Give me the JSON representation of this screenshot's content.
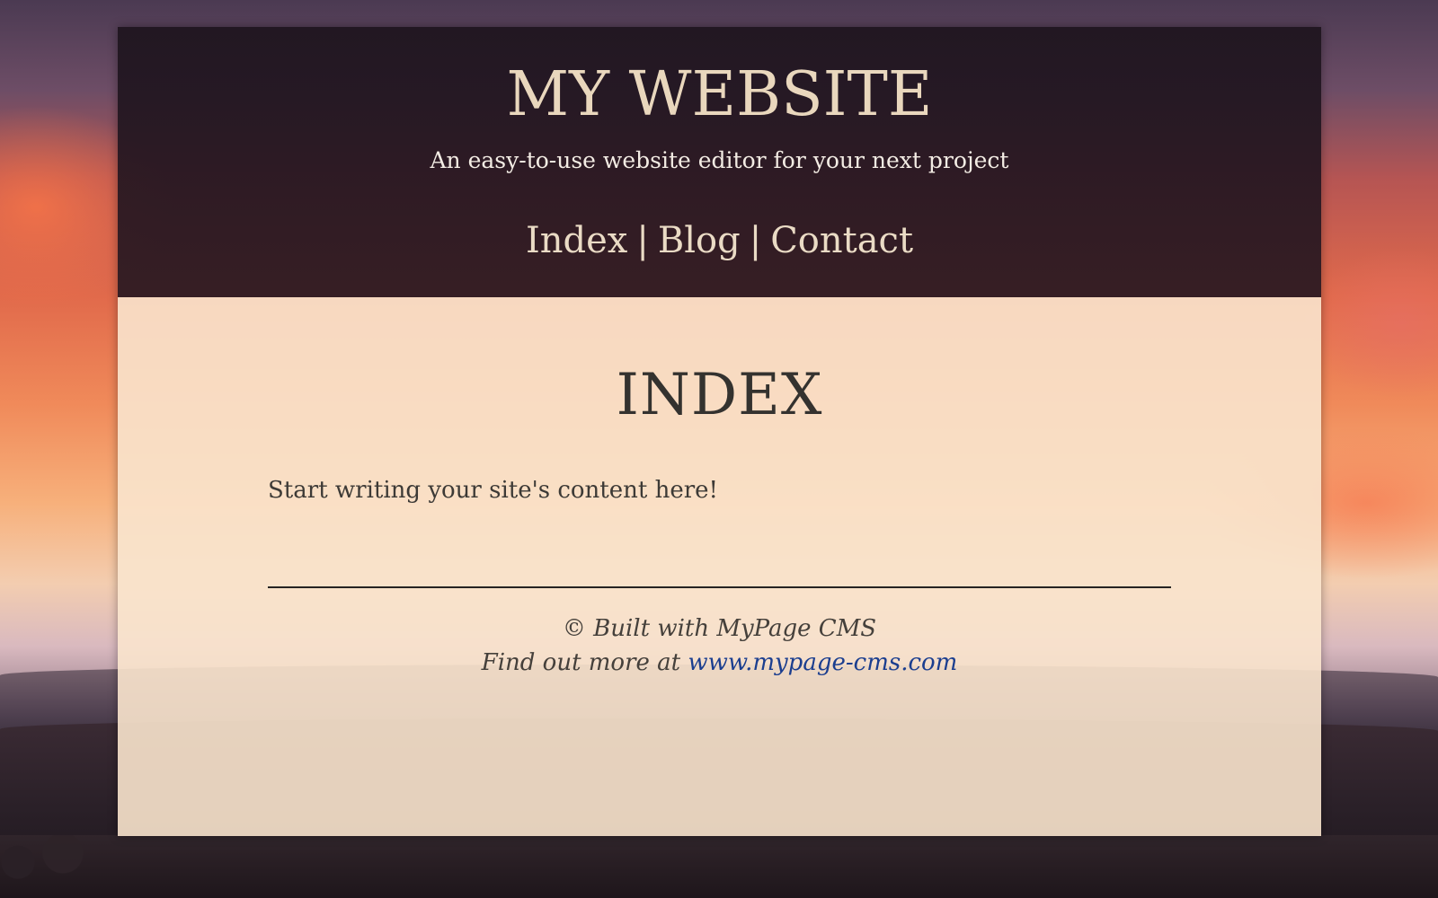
{
  "site": {
    "title": "MY WEBSITE",
    "tagline": "An easy-to-use website editor for your next project"
  },
  "nav": {
    "items": [
      {
        "label": "Index"
      },
      {
        "label": "Blog"
      },
      {
        "label": "Contact"
      }
    ],
    "separator": "|"
  },
  "page": {
    "heading": "INDEX",
    "content": "Start writing your site's content here!"
  },
  "footer": {
    "credit": "© Built with MyPage CMS",
    "more_prefix": "Find out more at",
    "link_label": "www.mypage-cms.com"
  },
  "colors": {
    "header_bg": "#231823",
    "header_text": "#e9d7bd",
    "main_bg": "#fae4cd",
    "body_text": "#3a3734",
    "link": "#1b3e8f"
  }
}
